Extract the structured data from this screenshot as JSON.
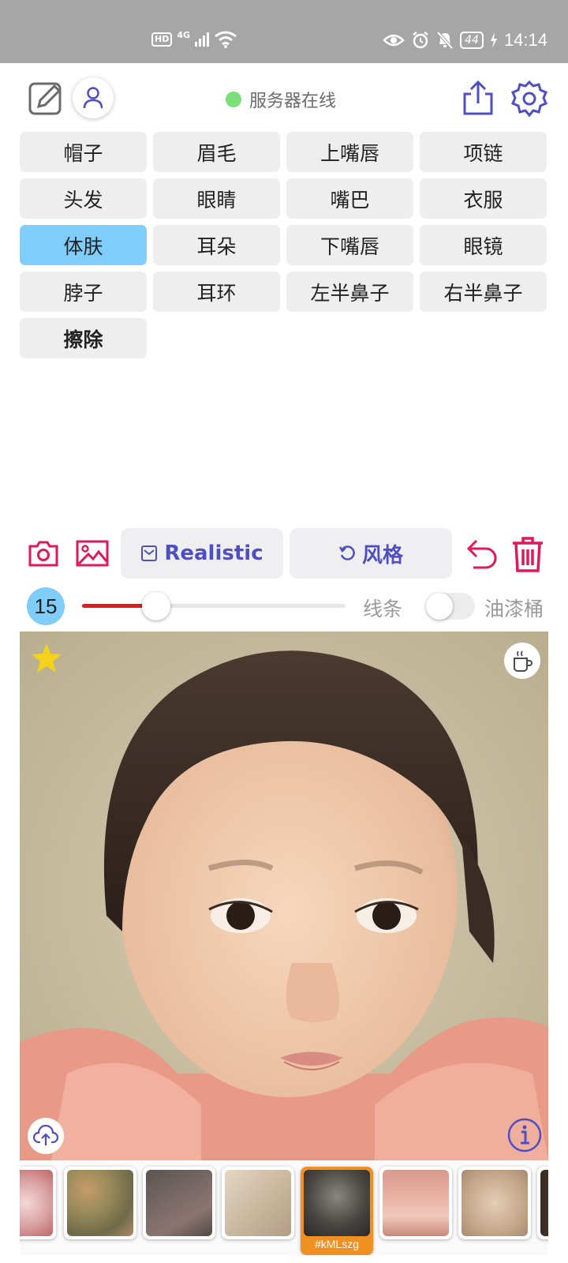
{
  "status_bar": {
    "network_badge": "HD",
    "network_type": "4G",
    "battery": "44",
    "time": "14:14",
    "icons": [
      "hd-icon",
      "signal-icon",
      "wifi-icon",
      "eye-icon",
      "alarm-icon",
      "bell-off-icon",
      "battery-icon",
      "charging-icon"
    ]
  },
  "header": {
    "server_status": "服务器在线",
    "server_status_color": "#7be07a",
    "accent_color": "#4f4fc2"
  },
  "segments": [
    {
      "label": "帽子",
      "active": false
    },
    {
      "label": "眉毛",
      "active": false
    },
    {
      "label": "上嘴唇",
      "active": false
    },
    {
      "label": "项链",
      "active": false
    },
    {
      "label": "头发",
      "active": false
    },
    {
      "label": "眼睛",
      "active": false
    },
    {
      "label": "嘴巴",
      "active": false
    },
    {
      "label": "衣服",
      "active": false
    },
    {
      "label": "体肤",
      "active": true
    },
    {
      "label": "耳朵",
      "active": false
    },
    {
      "label": "下嘴唇",
      "active": false
    },
    {
      "label": "眼镜",
      "active": false
    },
    {
      "label": "脖子",
      "active": false
    },
    {
      "label": "耳环",
      "active": false
    },
    {
      "label": "左半鼻子",
      "active": false
    },
    {
      "label": "右半鼻子",
      "active": false
    },
    {
      "label": "擦除",
      "active": false
    }
  ],
  "toolbar": {
    "model_label": "Realistic",
    "style_label": "风格",
    "tool_color": "#e0195a"
  },
  "brush": {
    "size": "15",
    "level": 0.28,
    "line_label": "线条",
    "bucket_label": "油漆桶",
    "bucket_enabled": false,
    "fill_color": "#e31b1b"
  },
  "thumbnails": {
    "selected_code": "#kMLszg",
    "selected_color": "#f09022"
  }
}
